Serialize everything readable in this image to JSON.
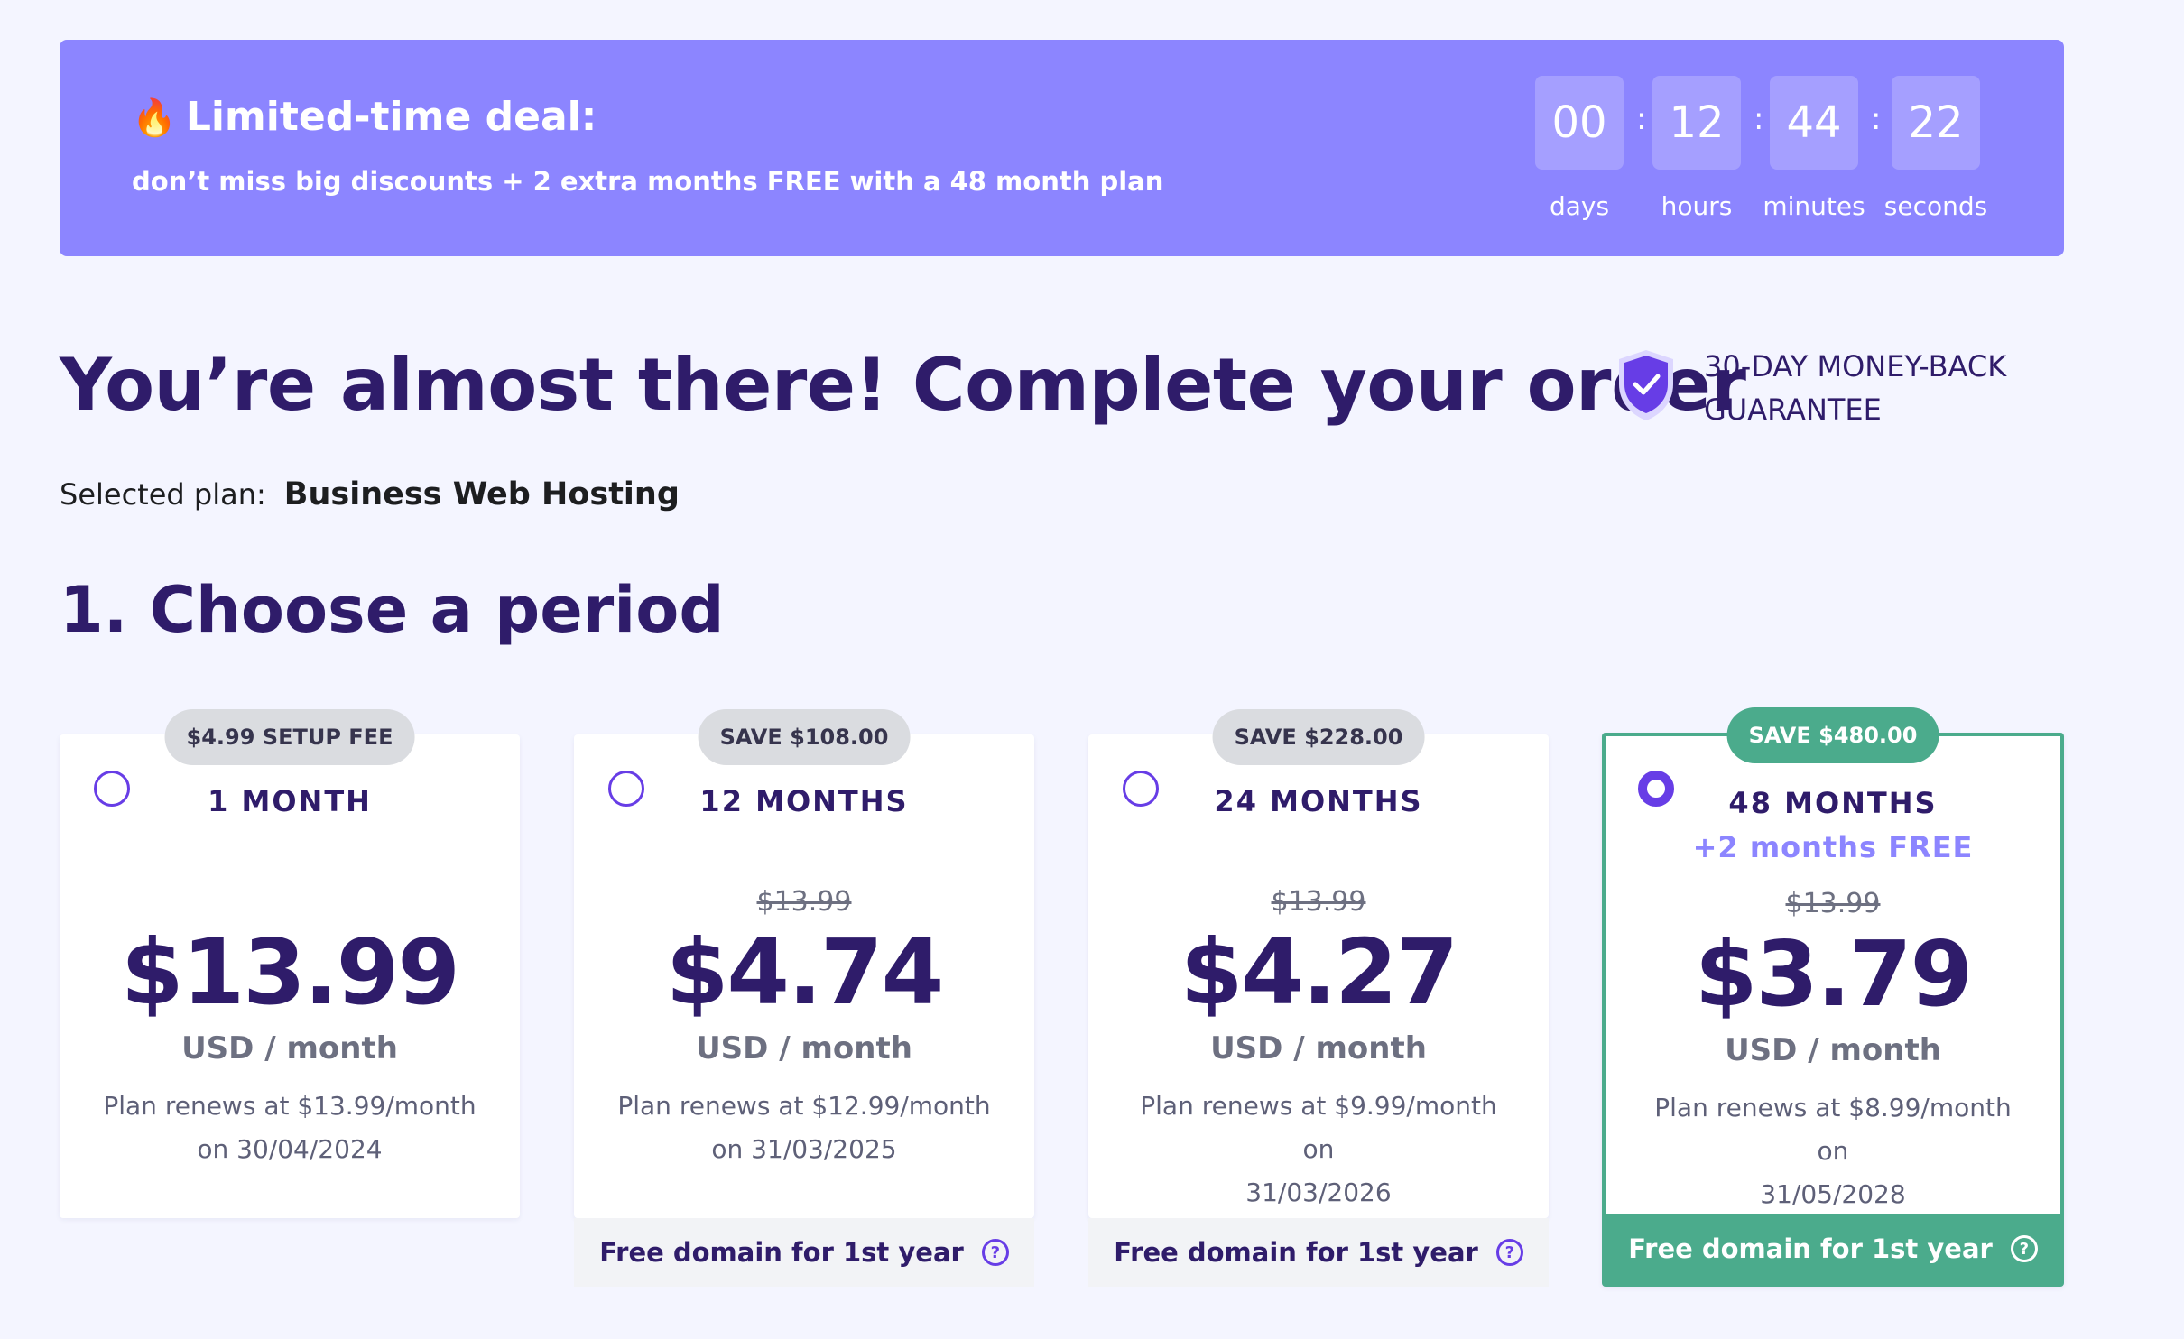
{
  "promo": {
    "icon": "fire-icon",
    "title": "Limited-time deal:",
    "subtitle": "don’t miss big discounts + 2 extra months FREE with a 48 month plan",
    "countdown": {
      "days": "00",
      "hours": "12",
      "minutes": "44",
      "seconds": "22",
      "days_label": "days",
      "hours_label": "hours",
      "minutes_label": "minutes",
      "seconds_label": "seconds",
      "separator": ":"
    }
  },
  "header": {
    "title": "You’re almost there! Complete your order",
    "guarantee_line1": "30-DAY MONEY-BACK",
    "guarantee_line2": "GUARANTEE",
    "selected_plan_label": "Selected plan:",
    "selected_plan_name": "Business Web Hosting"
  },
  "section": {
    "title": "1. Choose a period"
  },
  "plans": [
    {
      "badge": "$4.99 SETUP FEE",
      "period": "1 MONTH",
      "bonus": "",
      "old_price": "",
      "price": "$13.99",
      "unit": "USD / month",
      "renew_line1": "Plan renews at $13.99/month",
      "renew_line2": "on 30/04/2024",
      "footer": "",
      "selected": false
    },
    {
      "badge": "SAVE $108.00",
      "period": "12 MONTHS",
      "bonus": "",
      "old_price": "$13.99",
      "price": "$4.74",
      "unit": "USD / month",
      "renew_line1": "Plan renews at $12.99/month",
      "renew_line2": "on 31/03/2025",
      "footer": "Free domain for 1st year",
      "selected": false
    },
    {
      "badge": "SAVE $228.00",
      "period": "24 MONTHS",
      "bonus": "",
      "old_price": "$13.99",
      "price": "$4.27",
      "unit": "USD / month",
      "renew_line1": "Plan renews at $9.99/month on",
      "renew_line2": "31/03/2026",
      "footer": "Free domain for 1st year",
      "selected": false
    },
    {
      "badge": "SAVE $480.00",
      "period": "48 MONTHS",
      "bonus": "+2 months FREE",
      "old_price": "$13.99",
      "price": "$3.79",
      "unit": "USD / month",
      "renew_line1": "Plan renews at $8.99/month on",
      "renew_line2": "31/05/2028",
      "footer": "Free domain for 1st year",
      "selected": true
    }
  ],
  "help_glyph": "?",
  "colors": {
    "banner": "#8c85ff",
    "heading": "#2f1c6a",
    "accent": "#673de6",
    "selected_green": "#4bab8c"
  }
}
